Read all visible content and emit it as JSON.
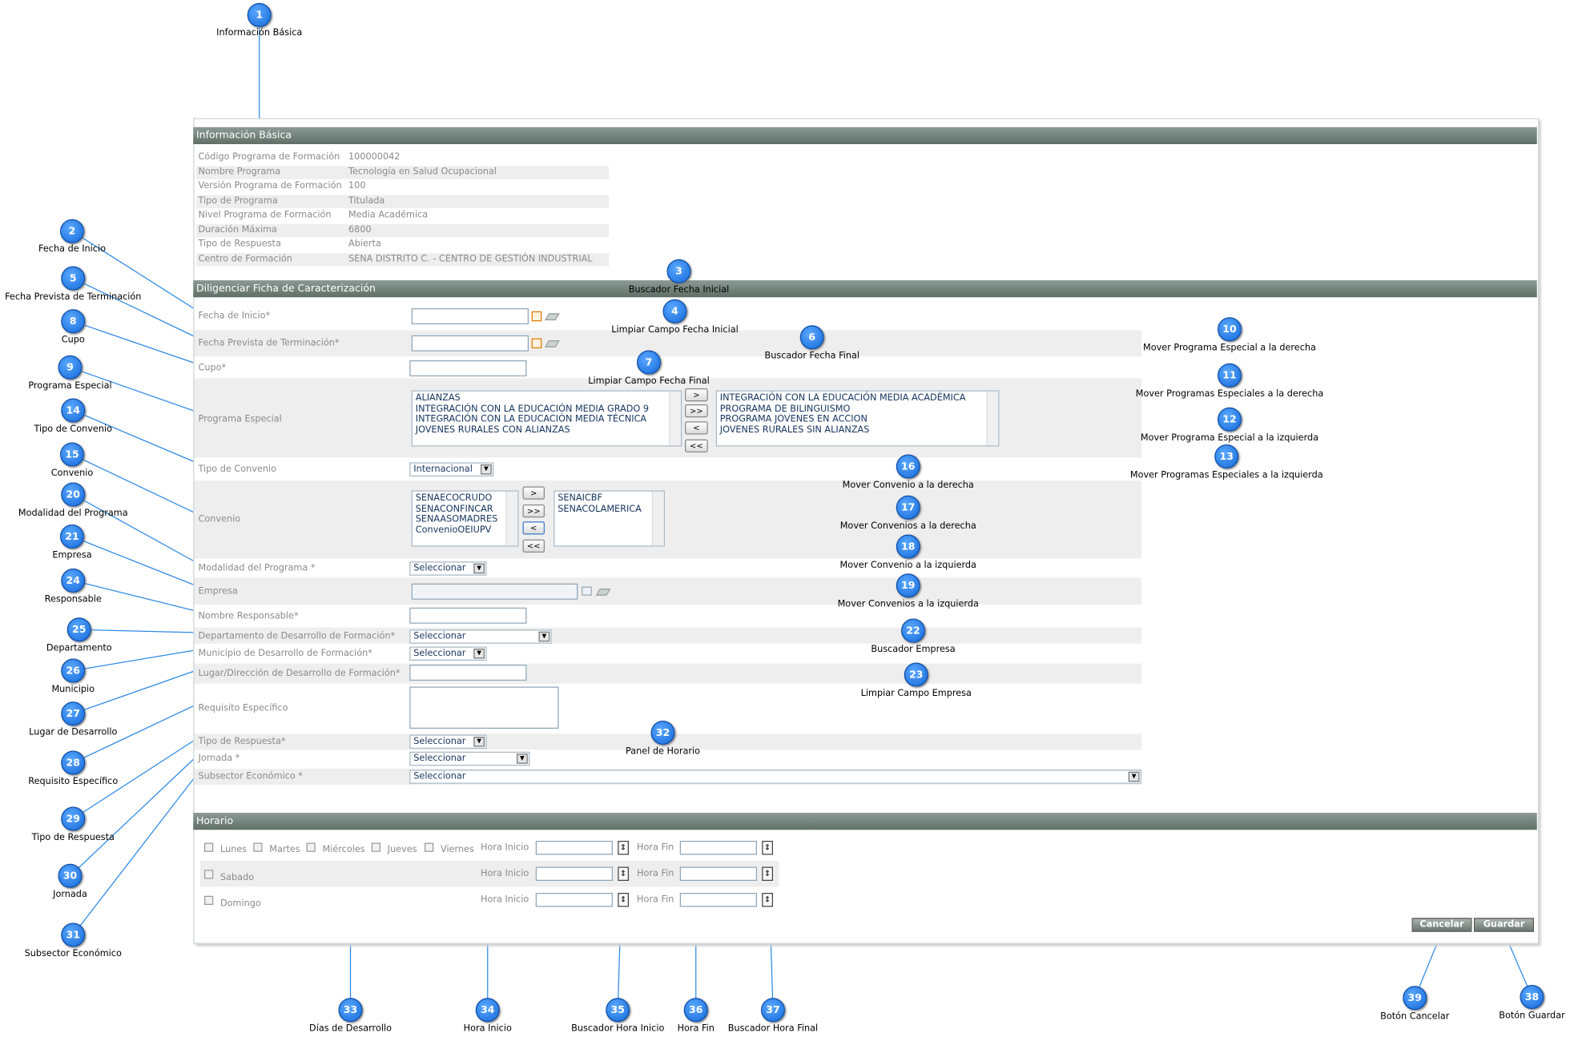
{
  "info": {
    "title": "Información Básica",
    "rows": [
      {
        "label": "Código Programa de Formación",
        "value": "100000042"
      },
      {
        "label": "Nombre Programa",
        "value": "Tecnología en Salud Ocupacional"
      },
      {
        "label": "Versión Programa de Formación",
        "value": "100"
      },
      {
        "label": "Tipo de Programa",
        "value": "Titulada"
      },
      {
        "label": "Nivel Programa de Formación",
        "value": "Media Académica"
      },
      {
        "label": "Duración Máxima",
        "value": "6800"
      },
      {
        "label": "Tipo de Respuesta",
        "value": "Abierta"
      },
      {
        "label": "Centro de Formación",
        "value": "SENA DISTRITO C. - CENTRO DE GESTIÓN INDUSTRIAL"
      }
    ]
  },
  "form": {
    "title": "Diligenciar Ficha de Caracterización",
    "fecha_inicio": "Fecha de Inicio*",
    "fecha_fin": "Fecha Prevista de Terminación*",
    "cupo": "Cupo*",
    "programa_especial": "Programa Especial",
    "programas_disponibles": [
      "ALIANZAS",
      "INTEGRACIÓN CON LA EDUCACIÓN MEDIA GRADO 9",
      "INTEGRACIÓN CON LA EDUCACIÓN MEDIA TÉCNICA",
      "JOVENES RURALES CON ALIANZAS"
    ],
    "programas_seleccionados": [
      "INTEGRACIÓN CON LA EDUCACIÓN MEDIA ACADÉMICA",
      "PROGRAMA DE BILINGUISMO",
      "PROGRAMA JOVENES EN ACCION",
      "JOVENES RURALES SIN ALIANZAS"
    ],
    "tipo_convenio": "Tipo de Convenio",
    "tipo_convenio_value": "Internacional",
    "convenio": "Convenio",
    "convenios_disponibles": [
      "SENAECOCRUDO",
      "SENACONFINCAR",
      "SENAASOMADRES",
      "ConvenioOEIUPV"
    ],
    "convenios_seleccionados": [
      "SENAICBF",
      "SENACOLAMERICA"
    ],
    "modalidad": "Modalidad del Programa *",
    "empresa": "Empresa",
    "responsable": "Nombre Responsable*",
    "departamento": "Departamento de Desarrollo de Formación*",
    "municipio": "Municipio de Desarrollo de Formación*",
    "lugar": "Lugar/Dirección de Desarrollo de Formación*",
    "requisito": "Requisito Específico",
    "tipo_respuesta": "Tipo de Respuesta*",
    "jornada": "Jornada *",
    "subsector": "Subsector Económico *",
    "select_placeholder": "Seleccionar",
    "btn_right": ">",
    "btn_all_right": ">>",
    "btn_left": "<",
    "btn_all_left": "<<"
  },
  "horario": {
    "title": "Horario",
    "days_row1": [
      "Lunes",
      "Martes",
      "Miércoles",
      "Jueves",
      "Viernes"
    ],
    "sabado": "Sabado",
    "domingo": "Domingo",
    "hora_inicio": "Hora Inicio",
    "hora_fin": "Hora Fin"
  },
  "actions": {
    "cancel": "Cancelar",
    "save": "Guardar"
  },
  "callouts": [
    {
      "n": "1",
      "text": "Información Básica"
    },
    {
      "n": "2",
      "text": "Fecha de Inicio"
    },
    {
      "n": "3",
      "text": "Buscador Fecha Inicial"
    },
    {
      "n": "4",
      "text": "Limpiar Campo Fecha Inicial"
    },
    {
      "n": "5",
      "text": "Fecha Prevista de Terminación"
    },
    {
      "n": "6",
      "text": "Buscador Fecha Final"
    },
    {
      "n": "7",
      "text": "Limpiar Campo Fecha Final"
    },
    {
      "n": "8",
      "text": "Cupo"
    },
    {
      "n": "9",
      "text": "Programa Especial"
    },
    {
      "n": "10",
      "text": "Mover Programa Especial a la derecha"
    },
    {
      "n": "11",
      "text": "Mover Programas Especiales a la derecha"
    },
    {
      "n": "12",
      "text": "Mover Programa Especial a la izquierda"
    },
    {
      "n": "13",
      "text": "Mover Programas Especiales a la izquierda"
    },
    {
      "n": "14",
      "text": "Tipo de Convenio"
    },
    {
      "n": "15",
      "text": "Convenio"
    },
    {
      "n": "16",
      "text": "Mover Convenio a la derecha"
    },
    {
      "n": "17",
      "text": "Mover Convenios a la derecha"
    },
    {
      "n": "18",
      "text": "Mover Convenio a la izquierda"
    },
    {
      "n": "19",
      "text": "Mover Convenios a la izquierda"
    },
    {
      "n": "20",
      "text": "Modalidad del Programa"
    },
    {
      "n": "21",
      "text": "Empresa"
    },
    {
      "n": "22",
      "text": "Buscador Empresa"
    },
    {
      "n": "23",
      "text": "Limpiar Campo Empresa"
    },
    {
      "n": "24",
      "text": "Responsable"
    },
    {
      "n": "25",
      "text": "Departamento"
    },
    {
      "n": "26",
      "text": "Municipio"
    },
    {
      "n": "27",
      "text": "Lugar de Desarrollo"
    },
    {
      "n": "28",
      "text": "Requisito  Específico"
    },
    {
      "n": "29",
      "text": "Tipo de Respuesta"
    },
    {
      "n": "30",
      "text": "Jornada"
    },
    {
      "n": "31",
      "text": "Subsector Económico"
    },
    {
      "n": "32",
      "text": "Panel de Horario"
    },
    {
      "n": "33",
      "text": "Días de Desarrollo"
    },
    {
      "n": "34",
      "text": "Hora Inicio"
    },
    {
      "n": "35",
      "text": "Buscador Hora Inicio"
    },
    {
      "n": "36",
      "text": "Hora Fin"
    },
    {
      "n": "37",
      "text": "Buscador Hora Final"
    },
    {
      "n": "38",
      "text": "Botón Guardar"
    },
    {
      "n": "39",
      "text": "Botón Cancelar"
    }
  ]
}
